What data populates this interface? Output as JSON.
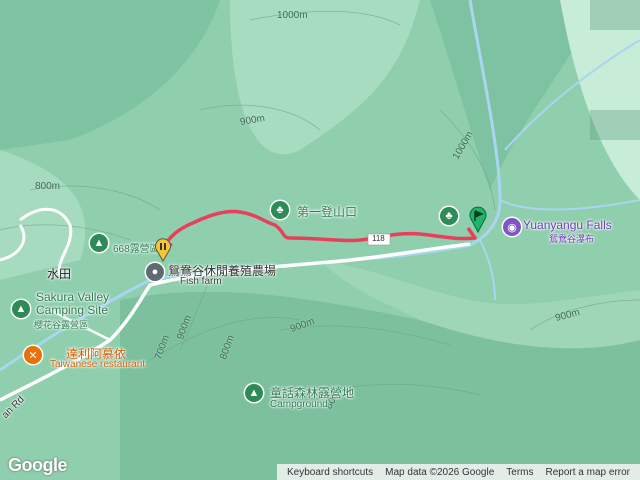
{
  "map": {
    "contours": [
      "1000m",
      "900m",
      "800m",
      "1000m",
      "900m",
      "700m",
      "800m",
      "900m",
      "800m",
      "900m"
    ],
    "places": {
      "shuitian": "水田",
      "sakura_en": "Sakura Valley Camping Site",
      "sakura_zh": "櫻花谷露營區",
      "restaurant_zh": "達利阿慕依",
      "restaurant_en": "Taiwanese restaurant",
      "camp668": "668露營區",
      "fishfarm_zh": "鴛鴦谷休閒養殖農場",
      "fishfarm_en": "Fish farm",
      "trailhead": "第一登山口",
      "falls_en": "Yuanyangu Falls",
      "falls_zh": "鴛鴦谷瀑布",
      "fairy_zh": "童話森林露營地",
      "fairy_en": "Campground",
      "road_label": "an Rd",
      "road_number": "118"
    },
    "icons": {
      "campsite": "tent-icon",
      "restaurant": "fork-knife-icon",
      "fishfarm": "dot-icon",
      "trailhead": "tree-icon",
      "falls": "camera-icon",
      "start_marker": "pause-pin-icon",
      "end_marker": "flag-pin-icon"
    },
    "colors": {
      "route": "#e8405a",
      "river": "#aad5f0",
      "road": "#ffffff",
      "terrain": "#8fcfae"
    }
  },
  "attribution": {
    "logo": "Google",
    "shortcuts": "Keyboard shortcuts",
    "map_data": "Map data ©2026 Google",
    "terms": "Terms",
    "report": "Report a map error"
  }
}
